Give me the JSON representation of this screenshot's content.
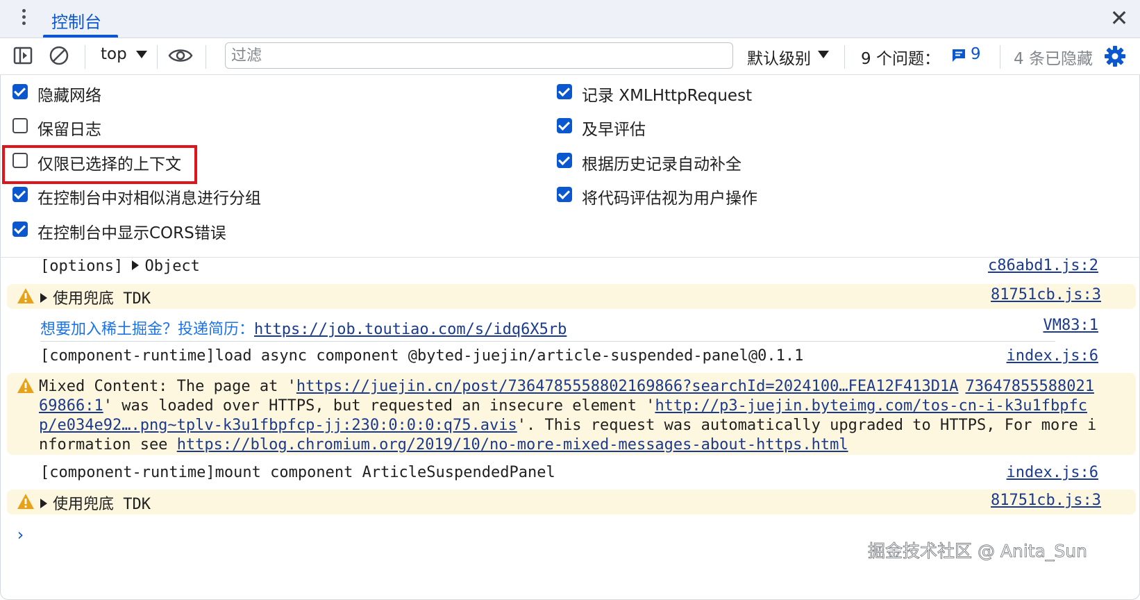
{
  "tabs": {
    "active_label": "控制台"
  },
  "toolbar": {
    "context": "top",
    "filter_placeholder": "过滤",
    "filter_value": "",
    "level": "默认级别",
    "issues_label": "9 个问题：",
    "issues_count": "9",
    "hidden": "4 条已隐藏"
  },
  "settings": {
    "left": [
      {
        "label": "隐藏网络",
        "checked": true
      },
      {
        "label": "保留日志",
        "checked": false
      },
      {
        "label": "仅限已选择的上下文",
        "checked": false
      },
      {
        "label": "在控制台中对相似消息进行分组",
        "checked": true
      },
      {
        "label": "在控制台中显示CORS错误",
        "checked": true
      }
    ],
    "right": [
      {
        "label": "记录 XMLHttpRequest",
        "checked": true
      },
      {
        "label": "及早评估",
        "checked": true
      },
      {
        "label": "根据历史记录自动补全",
        "checked": true
      },
      {
        "label": "将代码评估视为用户操作",
        "checked": true
      }
    ]
  },
  "console": {
    "r1": {
      "prefix": "[options] ",
      "obj": "Object",
      "src": "c86abd1.js:2"
    },
    "r2": {
      "text": "使用兜底",
      "tdk": " TDK",
      "src": "81751cb.js:3"
    },
    "r3": {
      "text": "想要加入稀土掘金？投递简历：",
      "link": "https://job.toutiao.com/s/idq6X5rb",
      "src": "VM83:1"
    },
    "r4": {
      "text": "[component-runtime]load async component @byted-juejin/article-suspended-panel@0.1.1",
      "src": "index.js:6"
    },
    "r5": {
      "a": "Mixed Content: The page at '",
      "link1": "https://juejin.cn/post/7364785558802169866?searchId=2024100…FEA12F413D1A",
      "b": "' was loaded over HTTPS, but requested an insecure element '",
      "link2": "http://p3-juejin.byteimg.com/tos-cn-i-k3u1fbpfcp/e034e92….png~tplv-k3u1fbpfcp-jj:230:0:0:0:q75.avis",
      "c": "'. This request was automatically upgraded to HTTPS, For more information see ",
      "link3": "https://blog.chromium.org/2019/10/no-more-mixed-messages-about-https.html",
      "src": "7364785558802169866:1"
    },
    "r6": {
      "text": "[component-runtime]mount component ArticleSuspendedPanel",
      "src": "index.js:6"
    },
    "r7": {
      "text": "使用兜底",
      "tdk": " TDK",
      "src": "81751cb.js:3"
    }
  },
  "watermark": "掘金技术社区 @ Anita_Sun",
  "colors": {
    "accent": "#0b57d0",
    "warning_bg": "#fef7e0",
    "warning_icon": "#e8a21a",
    "highlight": "#e0151c"
  }
}
